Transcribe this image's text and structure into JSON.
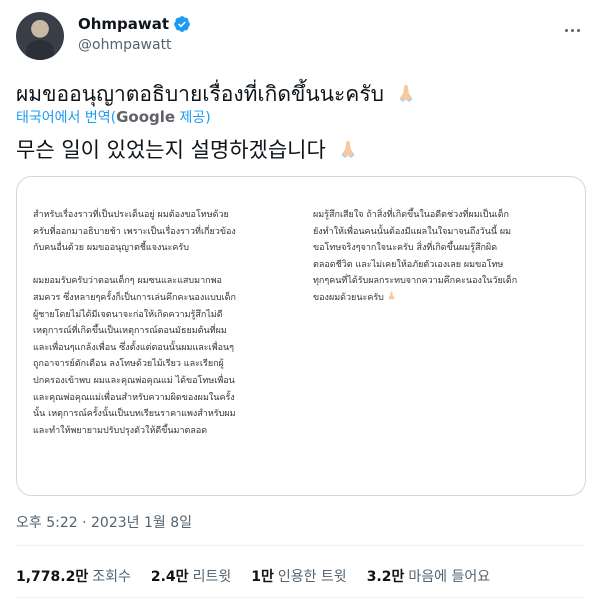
{
  "author": {
    "name": "Ohmpawat",
    "handle": "@ohmpawatt"
  },
  "tweet": {
    "text_thai": "ผมขออนุญาตอธิบายเรื่องที่เกิดขึ้นนะครับ",
    "translation_prefix": "태국어에서 번역(",
    "translation_brand": "Google",
    "translation_suffix": " 제공)",
    "text_korean": "무슨 일이 있었는지 설명하겠습니다"
  },
  "image": {
    "left_column": [
      "สำหรับเรื่องราวที่เป็นประเด็นอยู่ ผมต้องขอโทษด้วย",
      "ครับที่ออกมาอธิบายช้า เพราะเป็นเรื่องราวที่เกี่ยวข้อง",
      "กับคนอื่นด้วย ผมขออนุญาตชี้แจงนะครับ",
      "",
      "ผมยอมรับครับว่าตอนเด็กๆ ผมซนและแสบมากพอ",
      "สมควร ซึ่งหลายๆครั้งก็เป็นการเล่นคึกคะนองแบบเด็ก",
      "ผู้ชายโดยไม่ได้มีเจตนาจะก่อให้เกิดความรู้สึกไม่ดี",
      "เหตุการณ์ที่เกิดขึ้นเป็นเหตุการณ์ตอนมัธยมต้นที่ผม",
      "และเพื่อนๆแกล้งเพื่อน ซึ่งตั้งแต่ตอนนั้นผมและเพื่อนๆ",
      "ถูกอาจารย์ตักเตือน ลงโทษด้วยไม้เรียว และเรียกผู้",
      "ปกครองเข้าพบ ผมและคุณพ่อคุณแม่ ได้ขอโทษเพื่อน",
      "และคุณพ่อคุณแม่เพื่อนสำหรับความผิดของผมในครั้ง",
      "นั้น เหตุการณ์ครั้งนั้นเป็นบทเรียนราคาแพงสำหรับผม",
      "และทำให้พยายามปรับปรุงตัวให้ดีขึ้นมาตลอด"
    ],
    "right_column": [
      "ผมรู้สึกเสียใจ ถ้าสิ่งที่เกิดขึ้นในอดีตช่วงที่ผมเป็นเด็ก",
      "ยังทำให้เพื่อนคนนั้นต้องมีแผลในใจมาจนถึงวันนี้ ผม",
      "ขอโทษจริงๆจากใจนะครับ สิ่งที่เกิดขึ้นผมรู้สึกผิด",
      "ตลอดชีวิต และไม่เคยให้อภัยตัวเองเลย ผมขอโทษ",
      "ทุกๆคนที่ได้รับผลกระทบจากความคึกคะนองในวัยเด็ก",
      "ของผมด้วยนะครับ"
    ]
  },
  "timestamp": "오후 5:22 · 2023년 1월 8일",
  "stats": [
    {
      "count": "1,778.2만",
      "label": "조회수"
    },
    {
      "count": "2.4만",
      "label": "리트윗"
    },
    {
      "count": "1만",
      "label": "인용한 트윗"
    },
    {
      "count": "3.2만",
      "label": "마음에 들어요"
    }
  ],
  "colors": {
    "accent": "#1d9bf0",
    "muted": "#536471",
    "text": "#0f1419",
    "border": "#cfd9de"
  },
  "icons": [
    "verified-badge-icon",
    "more-options-icon",
    "folded-hands-emoji-icon"
  ]
}
